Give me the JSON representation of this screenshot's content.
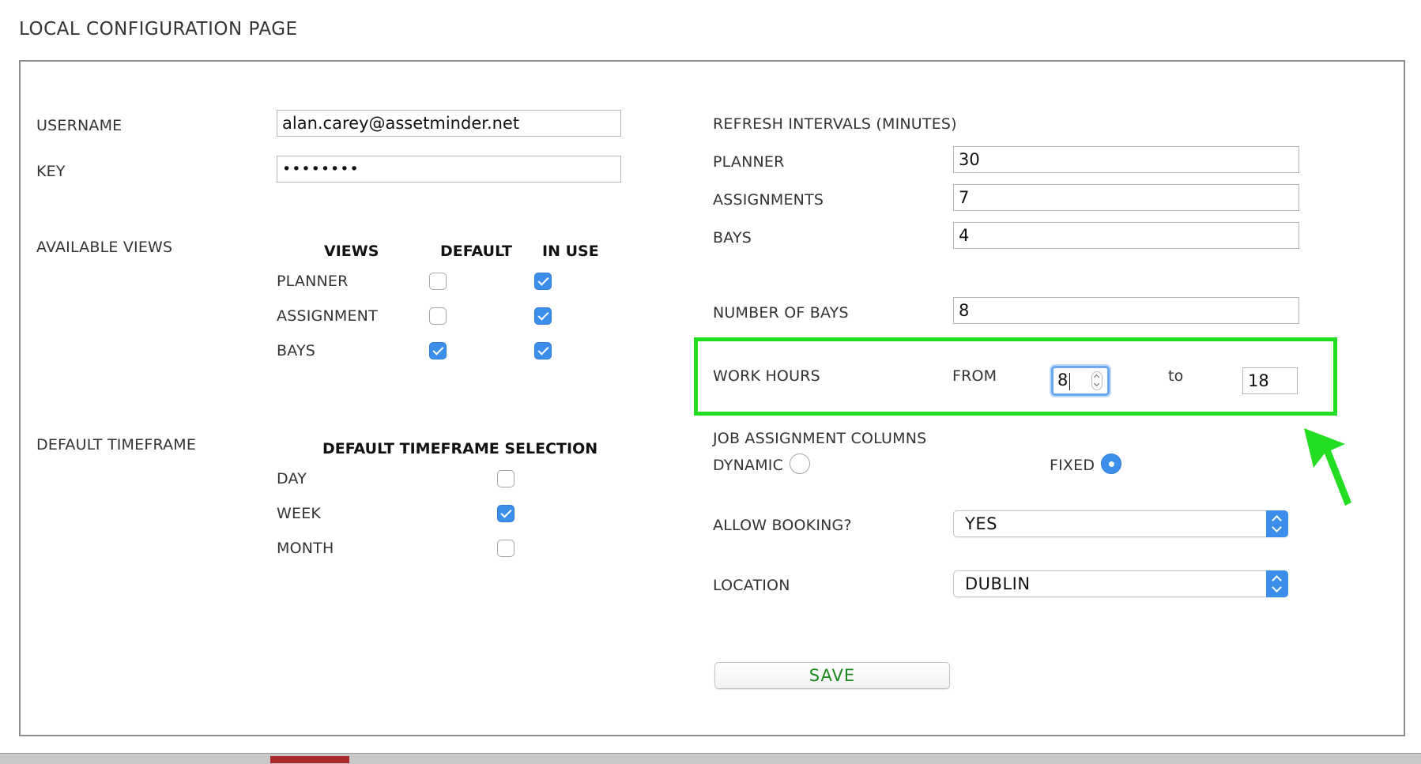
{
  "page": {
    "title": "LOCAL CONFIGURATION PAGE"
  },
  "account": {
    "username_label": "USERNAME",
    "username_value": "alan.carey@assetminder.net",
    "key_label": "KEY",
    "key_value": "password"
  },
  "views": {
    "section_label": "AVAILABLE VIEWS",
    "headers": {
      "views": "VIEWS",
      "default": "DEFAULT",
      "in_use": "IN USE"
    },
    "rows": [
      {
        "label": "PLANNER",
        "default": false,
        "in_use": true
      },
      {
        "label": "ASSIGNMENT",
        "default": false,
        "in_use": true
      },
      {
        "label": "BAYS",
        "default": true,
        "in_use": true
      }
    ]
  },
  "timeframe": {
    "section_label": "DEFAULT TIMEFRAME",
    "header": "DEFAULT TIMEFRAME SELECTION",
    "options": [
      {
        "label": "DAY",
        "checked": false
      },
      {
        "label": "WEEK",
        "checked": true
      },
      {
        "label": "MONTH",
        "checked": false
      }
    ]
  },
  "refresh": {
    "section_label": "REFRESH INTERVALS (MINUTES)",
    "planner_label": "PLANNER",
    "planner_value": "30",
    "assignments_label": "ASSIGNMENTS",
    "assignments_value": "7",
    "bays_label": "BAYS",
    "bays_value": "4"
  },
  "bays": {
    "label": "NUMBER OF BAYS",
    "value": "8"
  },
  "work_hours": {
    "label": "WORK HOURS",
    "from_label": "FROM",
    "from_value": "8",
    "to_label": "to",
    "to_value": "18"
  },
  "job_columns": {
    "label": "JOB ASSIGNMENT COLUMNS",
    "dynamic_label": "DYNAMIC",
    "fixed_label": "FIXED",
    "selected": "FIXED"
  },
  "booking": {
    "label": "ALLOW BOOKING?",
    "value": "YES"
  },
  "location": {
    "label": "LOCATION",
    "value": "DUBLIN"
  },
  "actions": {
    "save_label": "SAVE"
  },
  "colors": {
    "accent": "#3b8eea",
    "highlight": "#22dd22",
    "save_text": "#1a8a1a"
  }
}
